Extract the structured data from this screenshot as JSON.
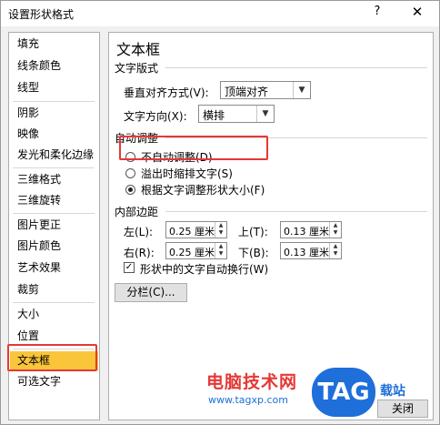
{
  "dialog": {
    "title": "设置形状格式",
    "help": "?",
    "close": "✕"
  },
  "sidebar": {
    "items": [
      {
        "label": "填充"
      },
      {
        "label": "线条颜色"
      },
      {
        "label": "线型"
      },
      {
        "label": "阴影"
      },
      {
        "label": "映像"
      },
      {
        "label": "发光和柔化边缘"
      },
      {
        "label": "三维格式"
      },
      {
        "label": "三维旋转"
      },
      {
        "label": "图片更正"
      },
      {
        "label": "图片颜色"
      },
      {
        "label": "艺术效果"
      },
      {
        "label": "裁剪"
      },
      {
        "label": "大小"
      },
      {
        "label": "位置"
      },
      {
        "label": "文本框",
        "active": true
      },
      {
        "label": "可选文字"
      }
    ]
  },
  "content": {
    "title": "文本框",
    "text_layout": {
      "label": "文字版式",
      "vertical_align_label": "垂直对齐方式(V):",
      "vertical_align_value": "顶端对齐",
      "text_direction_label": "文字方向(X):",
      "text_direction_value": "横排"
    },
    "autofit": {
      "label": "自动调整",
      "options": [
        {
          "label": "不自动调整(D)",
          "checked": false
        },
        {
          "label": "溢出时缩排文字(S)",
          "checked": false
        },
        {
          "label": "根据文字调整形状大小(F)",
          "checked": true
        }
      ]
    },
    "margins": {
      "label": "内部边距",
      "left_label": "左(L):",
      "left_value": "0.25 厘米",
      "top_label": "上(T):",
      "top_value": "0.13 厘米",
      "right_label": "右(R):",
      "right_value": "0.25 厘米",
      "bottom_label": "下(B):",
      "bottom_value": "0.13 厘米"
    },
    "wrap_text_label": "形状中的文字自动换行(W)",
    "wrap_text_checked": true,
    "columns_button": "分栏(C)..."
  },
  "footer": {
    "close_button": "关闭"
  },
  "watermark": {
    "text": "电脑技术网",
    "url": "www.tagxp.com",
    "badge": "TAG",
    "side": "载站"
  }
}
